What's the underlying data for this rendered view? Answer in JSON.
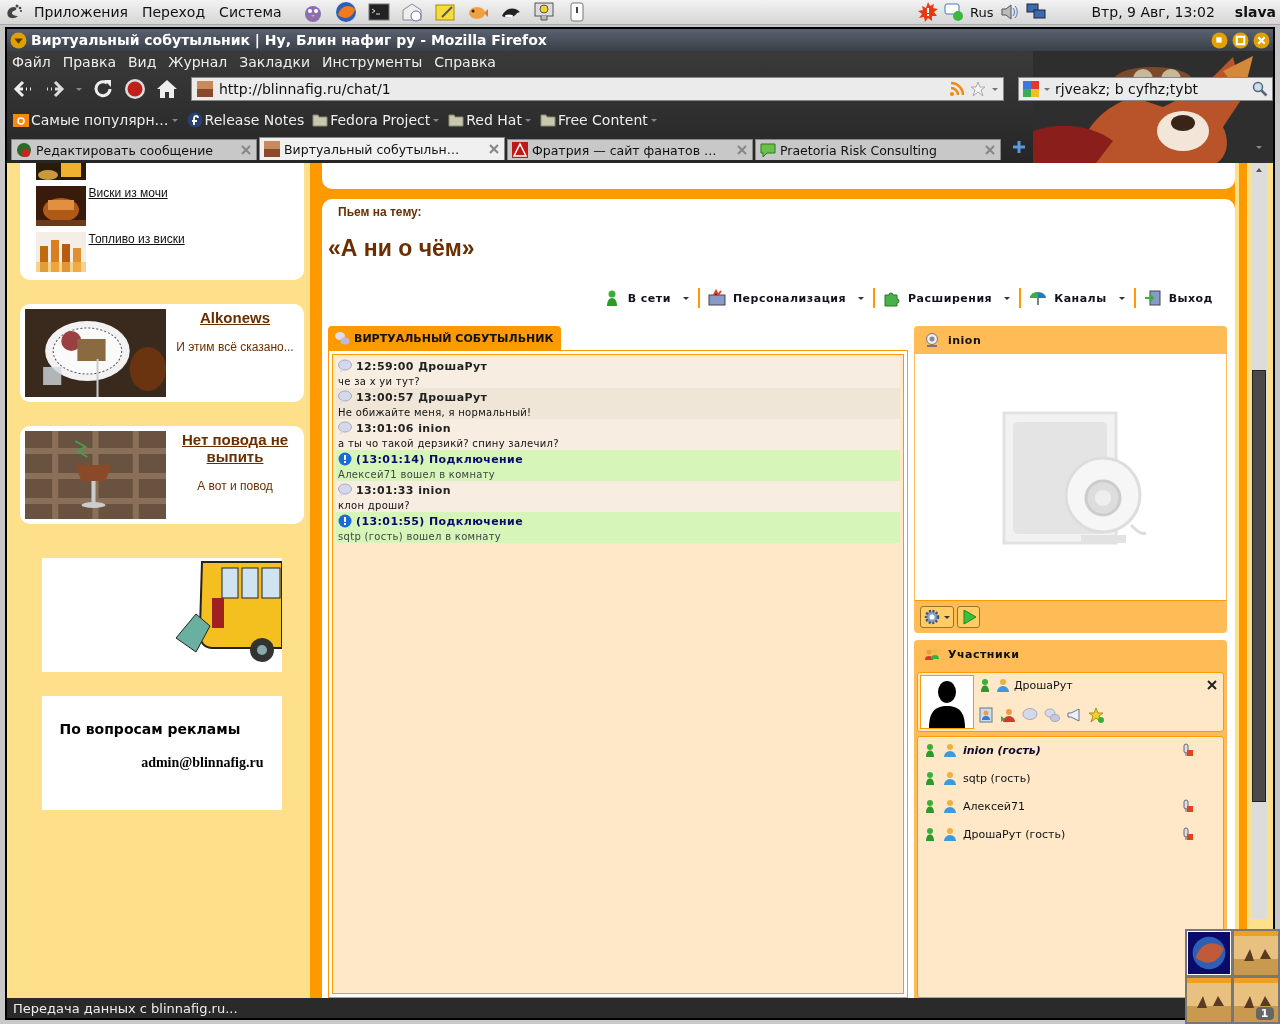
{
  "panel": {
    "menus": [
      "Приложения",
      "Переход",
      "Система"
    ],
    "keyboard": "Rus",
    "clock": "Втр,  9 Авг, 13:02",
    "user": "slava"
  },
  "window": {
    "title": "Виртуальный собутыльник | Ну, Блин нафиг ру - Mozilla Firefox"
  },
  "menu": [
    "Файл",
    "Правка",
    "Вид",
    "Журнал",
    "Закладки",
    "Инструменты",
    "Справка"
  ],
  "address": {
    "value": "http://blinnafig.ru/chat/1"
  },
  "search": {
    "value": "rjveakz; b cyfhz;tybt"
  },
  "bookmarks": [
    {
      "label": "Самые популярн…",
      "kind": "smart",
      "has_menu": true
    },
    {
      "label": "Release Notes",
      "kind": "fedora",
      "has_menu": false
    },
    {
      "label": "Fedora Project",
      "kind": "folder",
      "has_menu": true
    },
    {
      "label": "Red Hat",
      "kind": "folder",
      "has_menu": true
    },
    {
      "label": "Free Content",
      "kind": "folder",
      "has_menu": true
    }
  ],
  "tabs": [
    {
      "label": "Редактировать сообщение",
      "selected": false,
      "kind": "edit"
    },
    {
      "label": "Виртуальный собутыльн…",
      "selected": true,
      "kind": "site"
    },
    {
      "label": "Фратрия — сайт фанатов …",
      "selected": false,
      "kind": "warning"
    },
    {
      "label": "Praetoria Risk Consulting",
      "selected": false,
      "kind": "bubble"
    }
  ],
  "sidebar": {
    "links": [
      "Виски из мочи",
      "Топливо из виски"
    ],
    "cards": [
      {
        "title": "Alkonews",
        "text": "И этим всё сказано..."
      },
      {
        "title": "Нет повода не выпить",
        "text": "А вот и повод"
      }
    ],
    "ad": {
      "title": "По вопросам рекламы",
      "email": "admin@blinnafig.ru"
    }
  },
  "topic": {
    "label": "Пьем на тему:",
    "title": "«А ни о чём»"
  },
  "toolbar": [
    {
      "label": "В сети",
      "kind": "status",
      "has_menu": true
    },
    {
      "label": "Персонализация",
      "kind": "personal",
      "has_menu": true
    },
    {
      "label": "Расширения",
      "kind": "extensions",
      "has_menu": true
    },
    {
      "label": "Каналы",
      "kind": "channels",
      "has_menu": true
    },
    {
      "label": "Выход",
      "kind": "exit",
      "has_menu": false
    }
  ],
  "chat": {
    "title": "ВИРТУАЛЬНЫЙ СОБУТЫЛЬНИК",
    "messages": [
      {
        "kind": "message",
        "header": "12:59:00 ДрошаРут",
        "text": "че за х уи тут?"
      },
      {
        "kind": "message",
        "header": "13:00:57 ДрошаРут",
        "text": "Не обижайте меня, я нормальный!"
      },
      {
        "kind": "message",
        "header": "13:01:06 inion",
        "text": "а ты чо такой дерзикй? спину залечил?"
      },
      {
        "kind": "system",
        "header": "(13:01:14) Подключение",
        "text": "Алексей71 вошел в комнату"
      },
      {
        "kind": "message",
        "header": "13:01:33 inion",
        "text": "клон дроши?"
      },
      {
        "kind": "system",
        "header": "(13:01:55) Подключение",
        "text": "sqtp (гость) вошел в комнату"
      }
    ]
  },
  "video": {
    "title": "inion"
  },
  "participants": {
    "title": "Участники",
    "card": {
      "name": "ДрошаРут"
    },
    "users": [
      {
        "name": "inion (гость)",
        "selected": true,
        "mic": true
      },
      {
        "name": "sqtp (гость)",
        "selected": false,
        "mic": false
      },
      {
        "name": "Алексей71",
        "selected": false,
        "mic": true
      },
      {
        "name": "ДрошаРут (гость)",
        "selected": false,
        "mic": true
      }
    ]
  },
  "status_bar": "Передача данных с blinnafig.ru...",
  "workspace": "1"
}
